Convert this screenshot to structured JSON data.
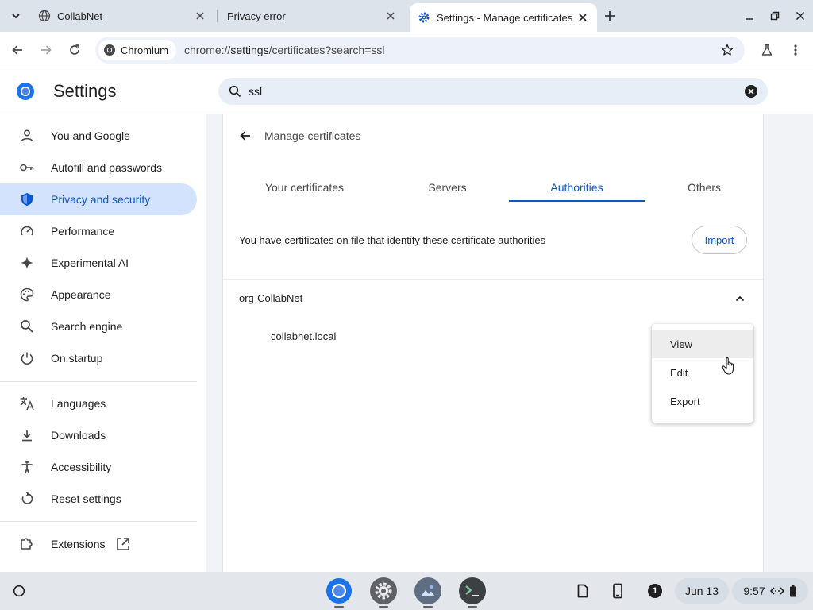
{
  "browser": {
    "tabs": [
      {
        "title": "CollabNet",
        "icon": "globe-icon",
        "active": false
      },
      {
        "title": "Privacy error",
        "icon": "",
        "active": false
      },
      {
        "title": "Settings - Manage certificates",
        "icon": "gear-icon",
        "active": true
      }
    ],
    "omnibox": {
      "chip_label": "Chromium",
      "url_scheme": "chrome://",
      "url_host": "settings",
      "url_path": "/certificates?search=ssl"
    }
  },
  "settings": {
    "title": "Settings",
    "search_value": "ssl",
    "sidebar": {
      "items": [
        {
          "label": "You and Google",
          "icon": "person-icon"
        },
        {
          "label": "Autofill and passwords",
          "icon": "key-icon"
        },
        {
          "label": "Privacy and security",
          "icon": "shield-icon",
          "active": true
        },
        {
          "label": "Performance",
          "icon": "speedometer-icon"
        },
        {
          "label": "Experimental AI",
          "icon": "sparkle-icon"
        },
        {
          "label": "Appearance",
          "icon": "palette-icon"
        },
        {
          "label": "Search engine",
          "icon": "search-icon"
        },
        {
          "label": "On startup",
          "icon": "power-icon"
        },
        {
          "label": "Languages",
          "icon": "translate-icon"
        },
        {
          "label": "Downloads",
          "icon": "download-icon"
        },
        {
          "label": "Accessibility",
          "icon": "accessibility-icon"
        },
        {
          "label": "Reset settings",
          "icon": "reset-icon"
        },
        {
          "label": "Extensions",
          "icon": "puzzle-icon"
        }
      ]
    },
    "certificates": {
      "page_title": "Manage certificates",
      "tabs": [
        "Your certificates",
        "Servers",
        "Authorities",
        "Others"
      ],
      "active_tab": "Authorities",
      "description": "You have certificates on file that identify these certificate authorities",
      "import_label": "Import",
      "org_name": "org-CollabNet",
      "certificate_name": "collabnet.local"
    },
    "context_menu": {
      "items": [
        "View",
        "Edit",
        "Export"
      ],
      "hovered": "View"
    }
  },
  "shelf": {
    "notification_count": "1",
    "date": "Jun 13",
    "time": "9:57"
  },
  "colors": {
    "accent": "#0b57d0",
    "active_nav_bg": "#d3e3fd",
    "tabstrip_bg": "#dde3ea",
    "shelf_bg": "#e3e7ec"
  }
}
